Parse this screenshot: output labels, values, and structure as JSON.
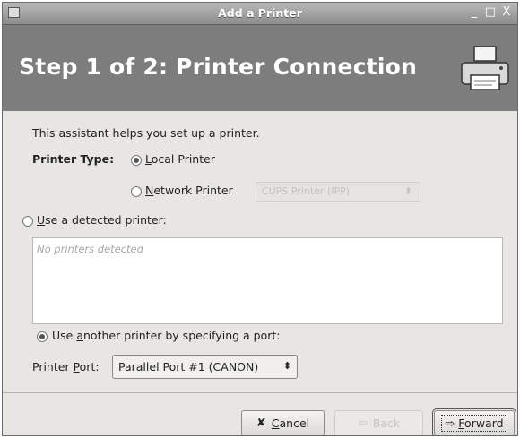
{
  "window": {
    "title": "Add a Printer",
    "controls": [
      "_",
      "□",
      "X"
    ]
  },
  "banner": {
    "heading": "Step 1 of 2: Printer Connection",
    "icon": "printer-icon"
  },
  "intro": "This assistant helps you set up a printer.",
  "printer_type": {
    "label": "Printer Type:",
    "local": {
      "pre": "",
      "u": "L",
      "post": "ocal Printer",
      "checked": true
    },
    "network": {
      "pre": "",
      "u": "N",
      "post": "etwork Printer",
      "checked": false
    },
    "network_select": "CUPS Printer (IPP)"
  },
  "detected": {
    "pre": "",
    "u": "U",
    "post": "se a detected printer:",
    "checked": false,
    "empty_text": "No printers detected"
  },
  "another": {
    "pre": "Use ",
    "u": "a",
    "post": "nother printer by specifying a port:",
    "checked": true
  },
  "port": {
    "label_pre": "Printer ",
    "label_u": "P",
    "label_post": "ort:",
    "value": "Parallel Port #1 (CANON)"
  },
  "buttons": {
    "cancel": {
      "u": "C",
      "post": "ancel"
    },
    "back": "Back",
    "forward": {
      "u": "F",
      "post": "orward"
    }
  }
}
